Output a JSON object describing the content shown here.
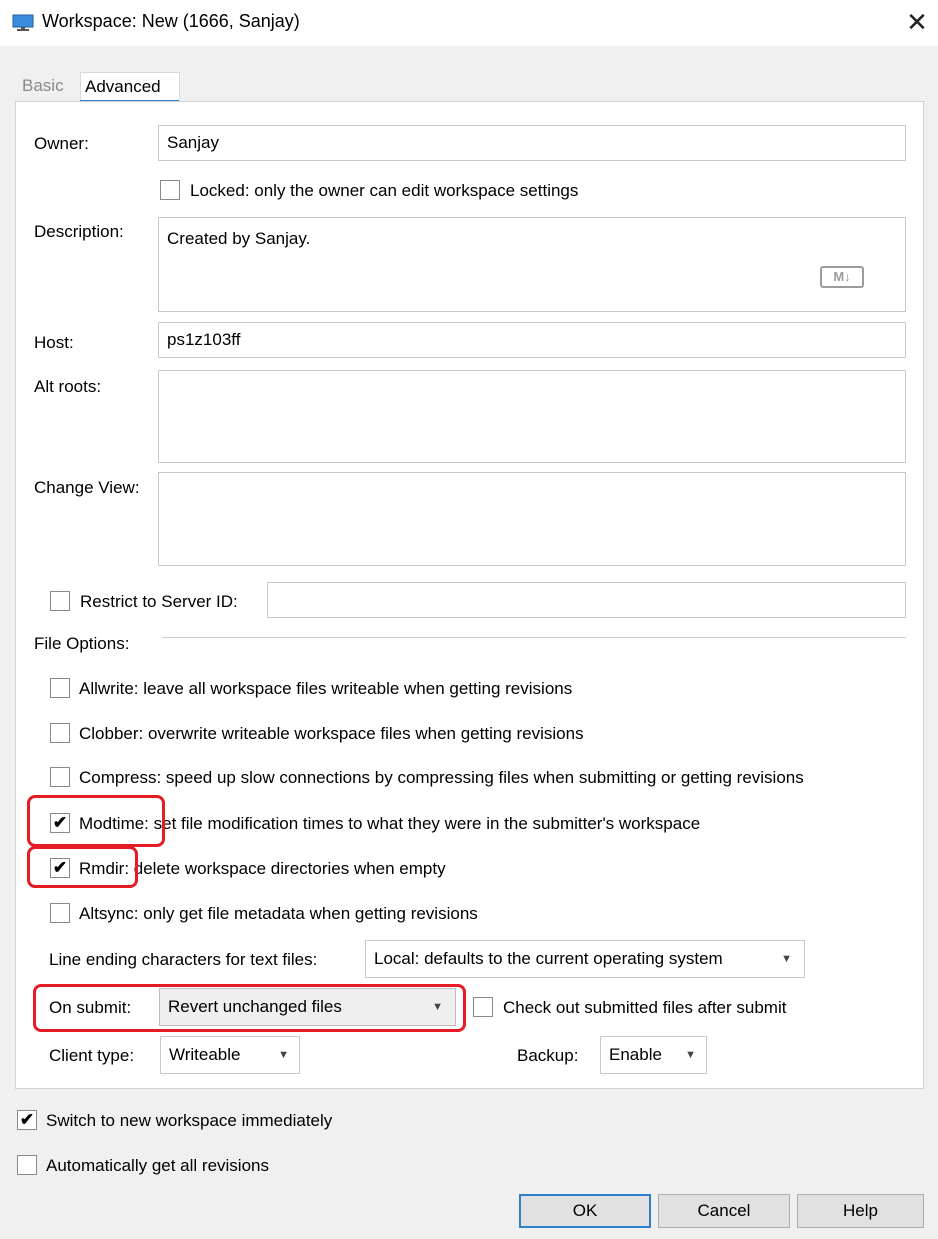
{
  "window": {
    "title": "Workspace: New (1666,  Sanjay)",
    "close_icon": "close-icon",
    "app_icon": "monitor-icon"
  },
  "tabs": [
    {
      "label": "Basic",
      "active": false
    },
    {
      "label": "Advanced",
      "active": true
    }
  ],
  "form": {
    "owner_label": "Owner:",
    "owner_value": "Sanjay",
    "locked_label": "Locked: only the owner can edit workspace settings",
    "locked_checked": false,
    "description_label": "Description:",
    "description_value": "Created by Sanjay.",
    "markdown_badge": "M↓",
    "host_label": "Host:",
    "host_value": "ps1z103ff",
    "alt_roots_label": "Alt roots:",
    "alt_roots_value": "",
    "change_view_label": "Change View:",
    "change_view_value": "",
    "restrict_label": "Restrict to Server ID:",
    "restrict_checked": false,
    "restrict_value": ""
  },
  "file_options": {
    "heading": "File Options:",
    "items": [
      {
        "label": "Allwrite: leave all workspace files writeable when getting revisions",
        "checked": false
      },
      {
        "label": "Clobber: overwrite writeable workspace files when getting revisions",
        "checked": false
      },
      {
        "label": "Compress: speed up slow connections by compressing files when submitting or getting revisions",
        "checked": false
      },
      {
        "label": "Modtime: set file modification times to what they were in the submitter's workspace",
        "checked": true
      },
      {
        "label": "Rmdir: delete workspace directories when empty",
        "checked": true
      },
      {
        "label": "Altsync: only get file metadata when getting revisions",
        "checked": false
      }
    ],
    "line_ending_label": "Line ending characters for text files:",
    "line_ending_value": "Local: defaults to the current operating system",
    "on_submit_label": "On submit:",
    "on_submit_value": "Revert unchanged files",
    "checkout_label": "Check out submitted files after submit",
    "checkout_checked": false,
    "client_type_label": "Client type:",
    "client_type_value": "Writeable",
    "backup_label": "Backup:",
    "backup_value": "Enable"
  },
  "bottom": {
    "switch_label": "Switch to new workspace immediately",
    "switch_checked": true,
    "autoget_label": "Automatically get all revisions",
    "autoget_checked": false
  },
  "buttons": {
    "ok": "OK",
    "cancel": "Cancel",
    "help": "Help"
  },
  "colors": {
    "highlight": "#e51c23",
    "accent": "#2f80c9"
  },
  "check_glyph": "✔"
}
